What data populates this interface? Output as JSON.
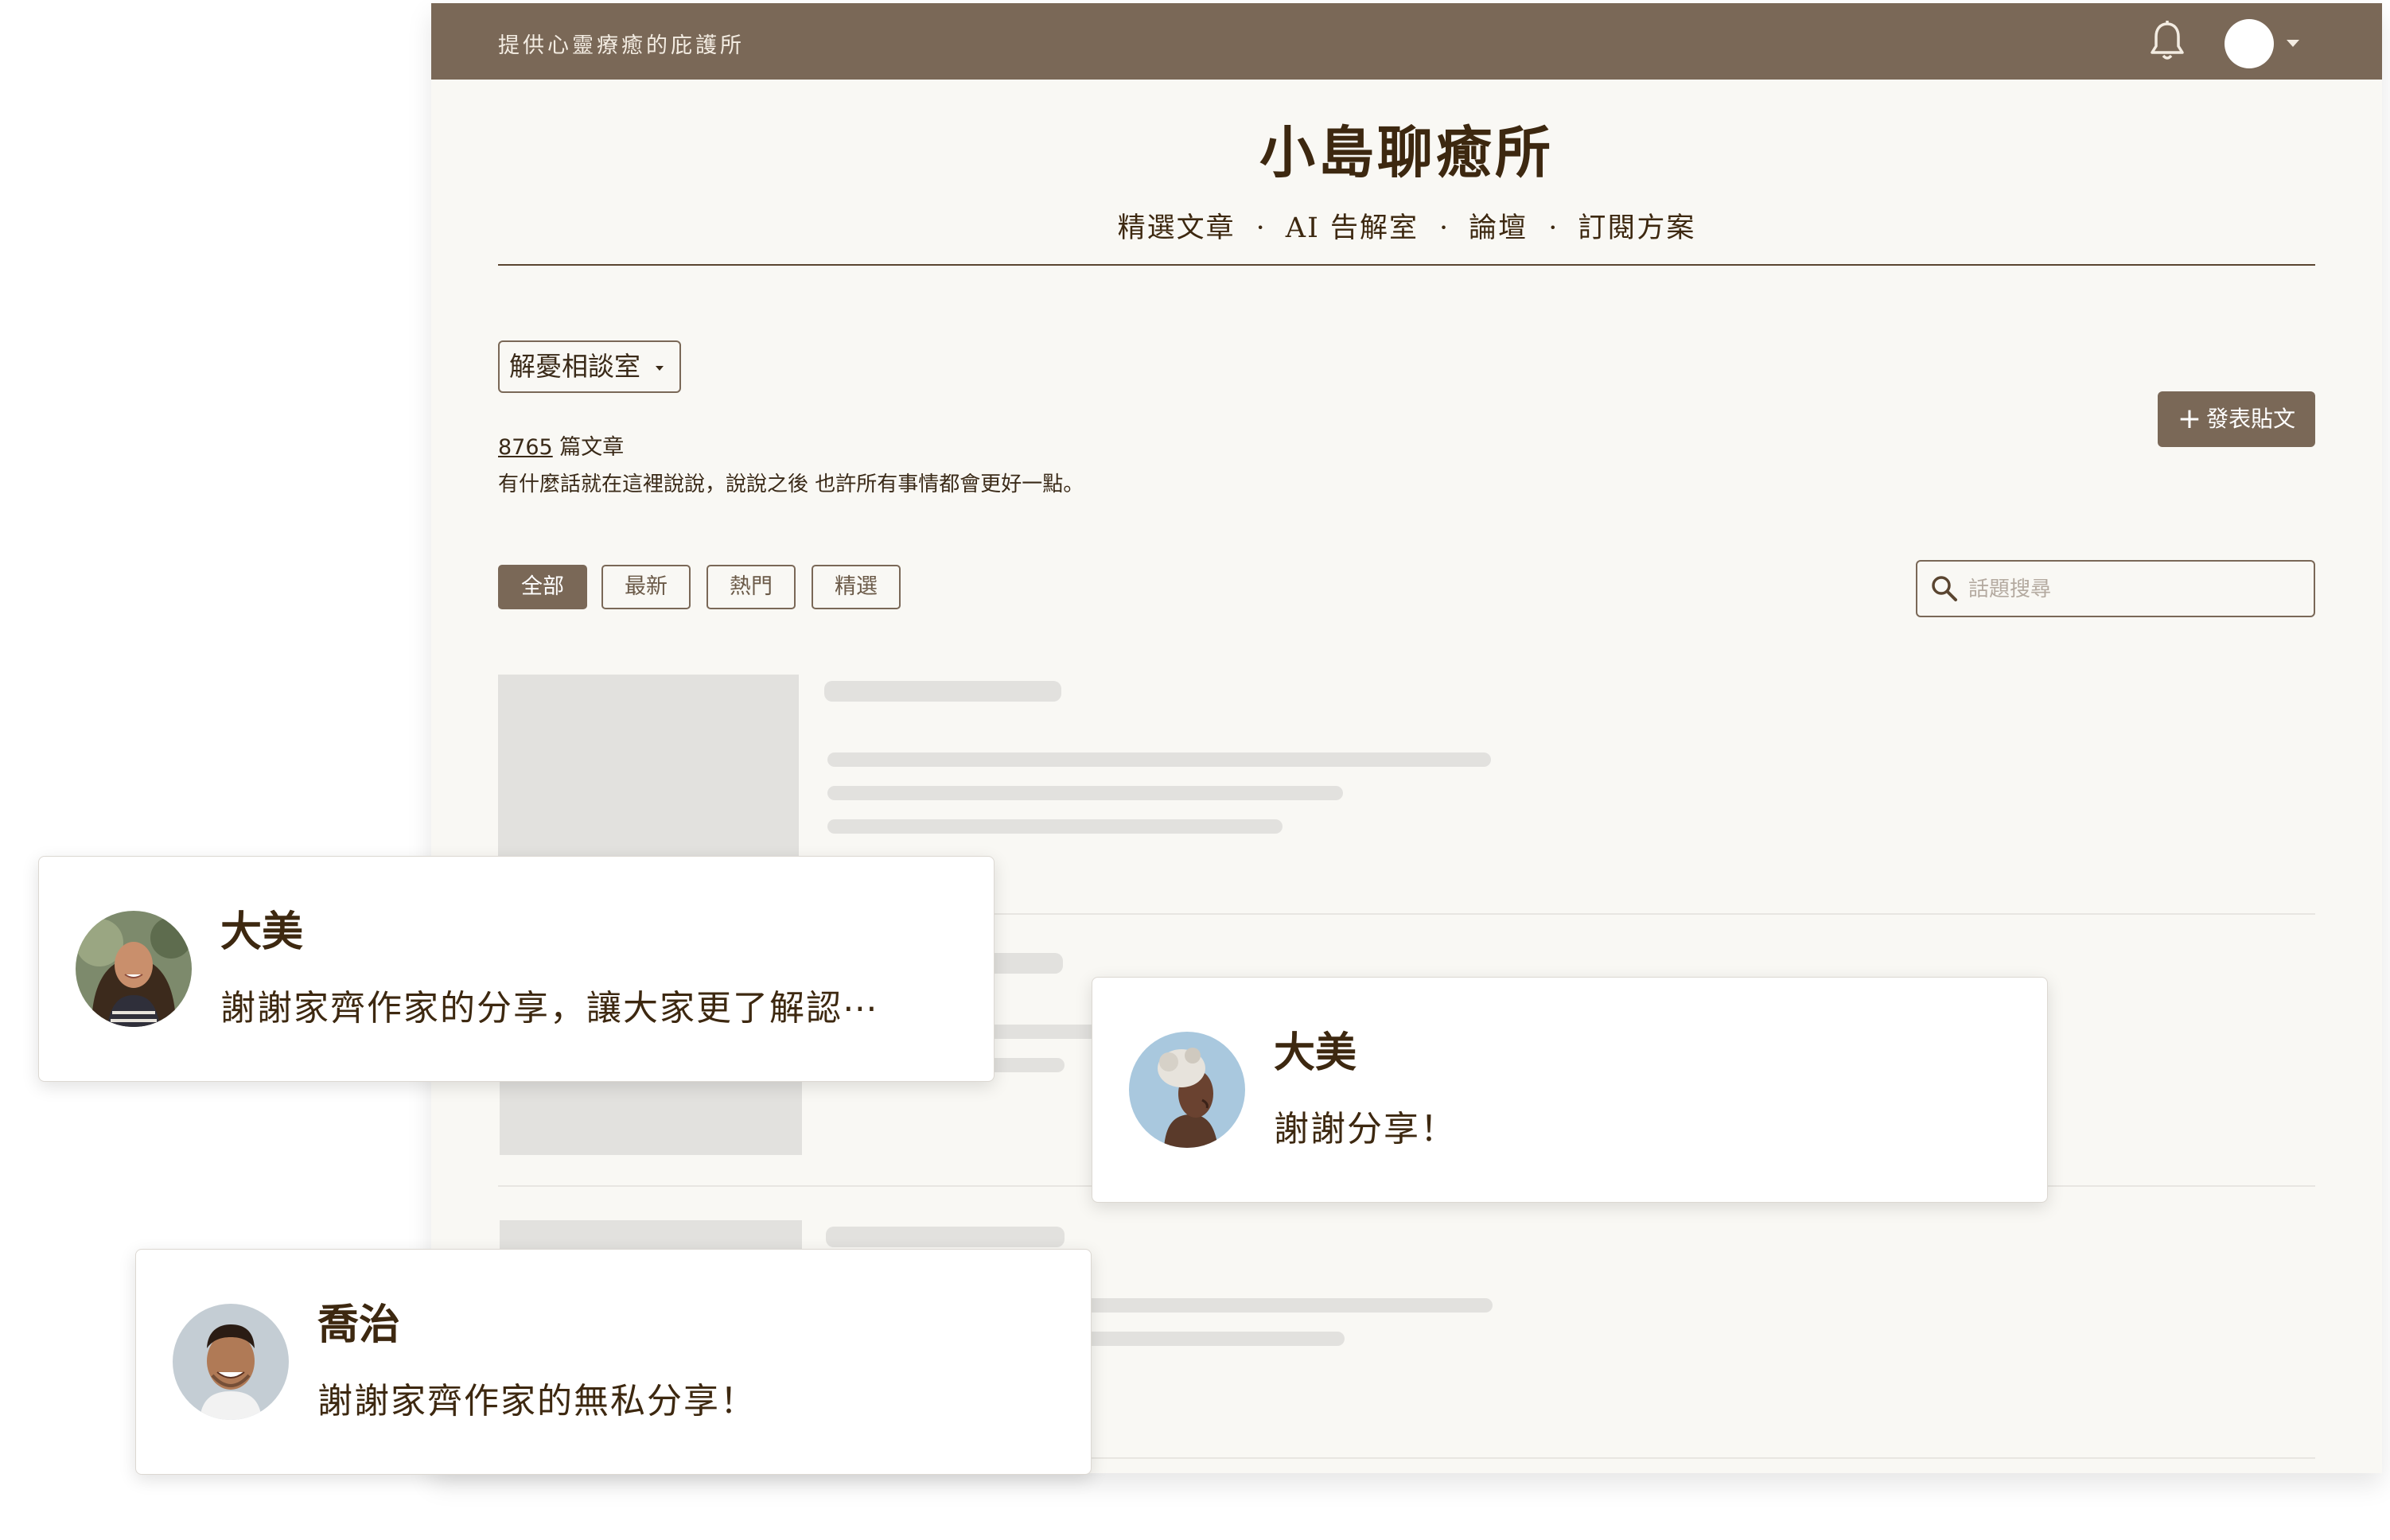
{
  "header": {
    "tagline": "提供心靈療癒的庇護所",
    "icons": [
      "bell-icon",
      "user-avatar",
      "caret-down-icon"
    ]
  },
  "site": {
    "title": "小島聊癒所",
    "nav": [
      "精選文章",
      "AI 告解室",
      "論壇",
      "訂閱方案"
    ],
    "nav_separator": "·"
  },
  "board": {
    "category": "解憂相談室",
    "post_count": "8765",
    "post_count_suffix": " 篇文章",
    "description": "有什麼話就在這裡說說，說說之後 也許所有事情都會更好一點。",
    "new_post_label": "發表貼文"
  },
  "filters": [
    {
      "label": "全部",
      "active": true
    },
    {
      "label": "最新",
      "active": false
    },
    {
      "label": "熱門",
      "active": false
    },
    {
      "label": "精選",
      "active": false
    }
  ],
  "search": {
    "placeholder": "話題搜尋"
  },
  "comments": [
    {
      "name": "大美",
      "message": "謝謝家齊作家的分享，讓大家更了解認⋯",
      "avatar": "woman-curly-hair-avatar"
    },
    {
      "name": "大美",
      "message": "謝謝分享！",
      "avatar": "woman-gray-hair-avatar"
    },
    {
      "name": "喬治",
      "message": "謝謝家齊作家的無私分享！",
      "avatar": "man-smiling-avatar"
    }
  ],
  "colors": {
    "brand": "#7a6857",
    "page_background": "#f9f8f4",
    "title_text": "#3d2810",
    "skeleton": "#e2e1de"
  }
}
